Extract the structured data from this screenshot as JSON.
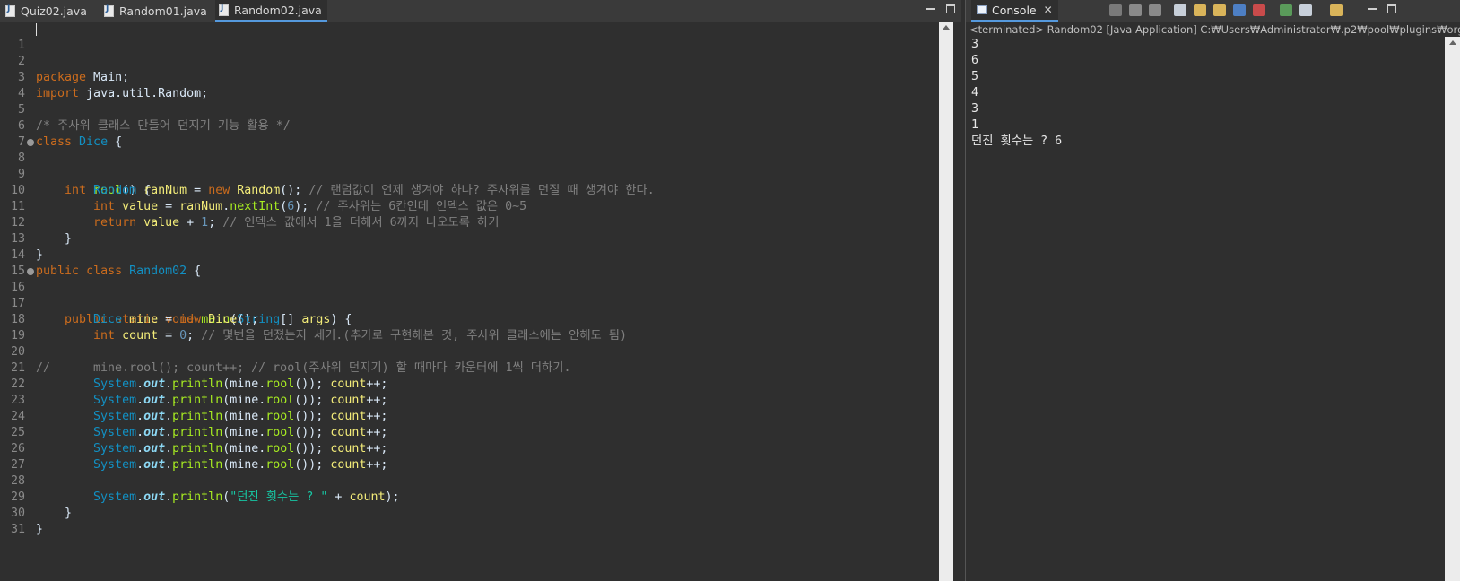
{
  "editor": {
    "tabs": [
      {
        "label": "Quiz02.java"
      },
      {
        "label": "Random01.java"
      },
      {
        "label": "Random02.java"
      }
    ],
    "active_tab": "Random02.java",
    "line_numbers": [
      "1",
      "2",
      "3",
      "4",
      "5",
      "6",
      "7",
      "8",
      "9",
      "10",
      "11",
      "12",
      "13",
      "14",
      "15",
      "16",
      "17",
      "18",
      "19",
      "20",
      "21",
      "22",
      "23",
      "24",
      "25",
      "26",
      "27",
      "28",
      "29",
      "30",
      "31"
    ],
    "code": {
      "l1_package": "package",
      "l1_rest": " Main;",
      "l3_import": "import",
      "l3_rest": " java.util.Random;",
      "l5_comment": "/* 주사위 클래스 만들어 던지기 기능 활용 */",
      "l6_class": "class",
      "l6_name": "Dice",
      "l6_rest": " {",
      "l8_int": "int",
      "l8_method": "rool",
      "l8_rest": "() {",
      "l9_type": "Random",
      "l9_var": "ranNum",
      "l9_eq": " = ",
      "l9_new": "new",
      "l9_ctor": "Random",
      "l9_rest": "(); ",
      "l9_comment": "// 랜덤값이 언제 생겨야 하나? 주사위를 던질 때 생겨야 한다.",
      "l10_int": "int",
      "l10_var": "value",
      "l10_eq": " = ",
      "l10_obj": "ranNum",
      "l10_dot": ".",
      "l10_method": "nextInt",
      "l10_open": "(",
      "l10_num": "6",
      "l10_close": "); ",
      "l10_comment": "// 주사위는 6칸인데 인덱스 값은 0~5",
      "l11_return": "return",
      "l11_var": "value",
      "l11_plus": " + ",
      "l11_num": "1",
      "l11_semi": "; ",
      "l11_comment": "// 인덱스 값에서 1을 더해서 6까지 나오도록 하기",
      "l12": "}",
      "l13": "}",
      "l14_public": "public",
      "l14_class": "class",
      "l14_name": "Random02",
      "l14_rest": " {",
      "l16_public": "public",
      "l16_static": "static",
      "l16_void": "void",
      "l16_method": "main",
      "l16_open": "(",
      "l16_type": "String",
      "l16_arr": "[] ",
      "l16_args": "args",
      "l16_rest": ") {",
      "l17_type": "Dice",
      "l17_var": "mine",
      "l17_eq": " = ",
      "l17_new": "new",
      "l17_ctor": "Dice",
      "l17_rest": "();",
      "l18_int": "int",
      "l18_var": "count",
      "l18_eq": " = ",
      "l18_num": "0",
      "l18_semi": "; ",
      "l18_comment": "// 몇번을 던졌는지 세기.(추가로 구현해본 것, 주사위 클래스에는 안해도 됨)",
      "l20_comment": "//      mine.rool(); count++; // rool(주사위 던지기) 할 때마다 카운터에 1씩 더하기.",
      "print_system": "System",
      "print_dot1": ".",
      "print_out": "out",
      "print_dot2": ".",
      "print_println": "println",
      "print_args_open": "(mine.",
      "print_rool": "rool",
      "print_args_close": "()); ",
      "print_count": "count",
      "print_inc": "++;",
      "l28_system": "System",
      "l28_dot1": ".",
      "l28_out": "out",
      "l28_dot2": ".",
      "l28_println": "println",
      "l28_open": "(",
      "l28_str": "\"던진 횟수는 ? \"",
      "l28_plus": " + ",
      "l28_count": "count",
      "l28_close": ");",
      "l29": "}",
      "l30": "}"
    }
  },
  "console": {
    "tab_label": "Console",
    "close_glyph": "✕",
    "header": "<terminated> Random02 [Java Application] C:₩Users₩Administrator₩.p2₩pool₩plugins₩org.",
    "output": [
      "3",
      "6",
      "5",
      "4",
      "3",
      "1",
      "던진 횟수는 ? 6"
    ]
  },
  "colors": {
    "background": "#2f2f2f",
    "keyword": "#cc6c1d",
    "class": "#1290c3",
    "method": "#a7ec21",
    "variable": "#f3ec79",
    "comment": "#808080",
    "string": "#17c6a3",
    "accent": "#5599dd"
  }
}
